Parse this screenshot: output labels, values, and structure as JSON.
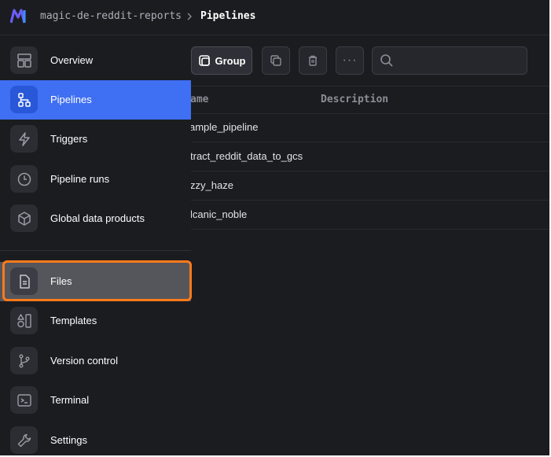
{
  "breadcrumb": {
    "project": "magic-de-reddit-reports",
    "current": "Pipelines"
  },
  "toolbar": {
    "group_label": "Group",
    "more_glyph": "···"
  },
  "table": {
    "columns": [
      "ame",
      "Description"
    ],
    "rows": [
      {
        "name": "ample_pipeline",
        "description": ""
      },
      {
        "name": "tract_reddit_data_to_gcs",
        "description": ""
      },
      {
        "name": "zzy_haze",
        "description": ""
      },
      {
        "name": "lcanic_noble",
        "description": ""
      }
    ]
  },
  "sidebar": {
    "items": [
      {
        "label": "Overview",
        "icon": "layout-icon"
      },
      {
        "label": "Pipelines",
        "icon": "pipeline-icon",
        "active": true
      },
      {
        "label": "Triggers",
        "icon": "lightning-icon"
      },
      {
        "label": "Pipeline runs",
        "icon": "clock-icon"
      },
      {
        "label": "Global data products",
        "icon": "cube-icon"
      },
      {
        "label": "Files",
        "icon": "file-icon",
        "highlighted": true
      },
      {
        "label": "Templates",
        "icon": "templates-icon"
      },
      {
        "label": "Version control",
        "icon": "branch-icon"
      },
      {
        "label": "Terminal",
        "icon": "terminal-icon"
      },
      {
        "label": "Settings",
        "icon": "wrench-icon"
      }
    ]
  },
  "colors": {
    "background": "#1b1c20",
    "active": "#3f6ff2",
    "highlight_outline": "#ff7a1a",
    "logo_primary": "#6c5cf6",
    "logo_secondary": "#3f8cf7"
  }
}
